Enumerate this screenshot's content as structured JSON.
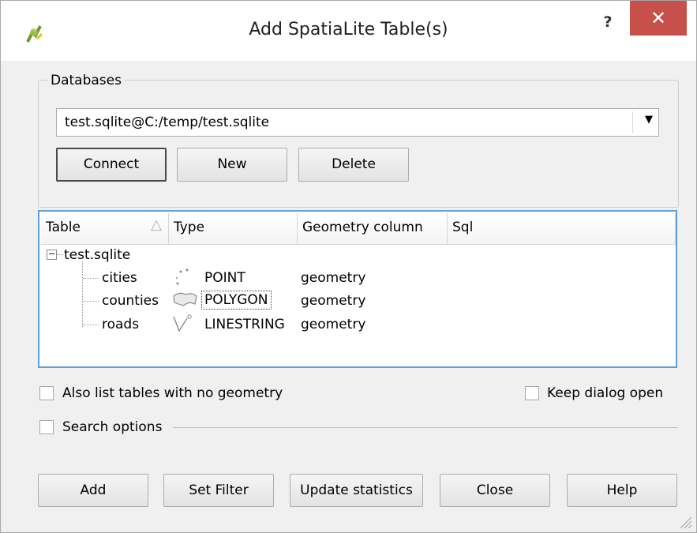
{
  "window": {
    "title": "Add SpatiaLite Table(s)",
    "help_glyph": "?",
    "close_glyph": "✕"
  },
  "databases": {
    "group_title": "Databases",
    "selected": "test.sqlite@C:/temp/test.sqlite",
    "buttons": {
      "connect": "Connect",
      "new": "New",
      "delete": "Delete"
    }
  },
  "table": {
    "headers": [
      "Table",
      "Type",
      "Geometry column",
      "Sql"
    ],
    "root": "test.sqlite",
    "rows": [
      {
        "name": "cities",
        "type": "POINT",
        "geometry": "geometry",
        "icon": "point-icon"
      },
      {
        "name": "counties",
        "type": "POLYGON",
        "geometry": "geometry",
        "icon": "polygon-icon"
      },
      {
        "name": "roads",
        "type": "LINESTRING",
        "geometry": "geometry",
        "icon": "line-icon"
      }
    ]
  },
  "options": {
    "also_list": "Also list tables with no geometry",
    "keep_open": "Keep dialog open",
    "search_options": "Search options"
  },
  "footer": {
    "add": "Add",
    "set_filter": "Set Filter",
    "update_statistics": "Update statistics",
    "close": "Close",
    "help": "Help"
  },
  "colors": {
    "close_red": "#c7504a",
    "focus_blue": "#5ea0dc"
  }
}
